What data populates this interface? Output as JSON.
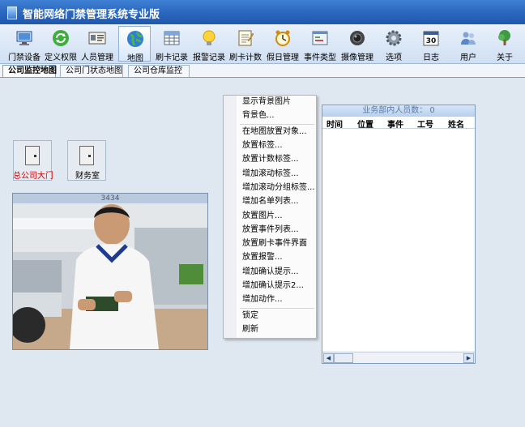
{
  "window": {
    "title": "智能网络门禁管理系统专业版"
  },
  "toolbar": {
    "items": [
      {
        "label": "门禁设备",
        "icon": "monitor-icon"
      },
      {
        "label": "定义权限",
        "icon": "refresh-icon"
      },
      {
        "label": "人员管理",
        "icon": "id-card-icon"
      },
      {
        "label": "地图",
        "icon": "globe-icon",
        "active": true
      },
      {
        "label": "刷卡记录",
        "icon": "grid-icon"
      },
      {
        "label": "报警记录",
        "icon": "bulb-icon"
      },
      {
        "label": "刷卡计数",
        "icon": "notepad-icon"
      },
      {
        "label": "假日管理",
        "icon": "clock-icon"
      },
      {
        "label": "事件类型",
        "icon": "window-icon"
      },
      {
        "label": "摄像管理",
        "icon": "camera-icon"
      },
      {
        "label": "选项",
        "icon": "gear-icon"
      },
      {
        "label": "日志",
        "icon": "calendar-icon",
        "calendar_day": "30"
      },
      {
        "label": "用户",
        "icon": "users-icon"
      },
      {
        "label": "关于",
        "icon": "tree-icon"
      }
    ]
  },
  "tabs": [
    {
      "label": "公司监控地图",
      "active": true
    },
    {
      "label": "公司门状态地图"
    },
    {
      "label": "公司仓库监控"
    }
  ],
  "map": {
    "doors": [
      {
        "label": "总公司大门"
      },
      {
        "label": "财务室"
      }
    ],
    "video": {
      "title": "3434"
    }
  },
  "panel": {
    "header": "业务部内人员数： 0",
    "columns": [
      "时间",
      "位置",
      "事件",
      "工号",
      "姓名"
    ]
  },
  "context_menu": {
    "items": [
      "显示背景图片",
      "背景色...",
      "在地图放置对象...",
      "放置标签...",
      "放置计数标签...",
      "增加滚动标签...",
      "增加滚动分组标签...",
      "增加名单列表...",
      "放置图片...",
      "放置事件列表...",
      "放置刷卡事件界面",
      "放置报警...",
      "增加确认提示...",
      "增加确认提示2...",
      "增加动作...",
      "锁定",
      "刷新"
    ]
  },
  "colors": {
    "accent": "#2a66bd",
    "door_alert_label": "#d00000"
  }
}
